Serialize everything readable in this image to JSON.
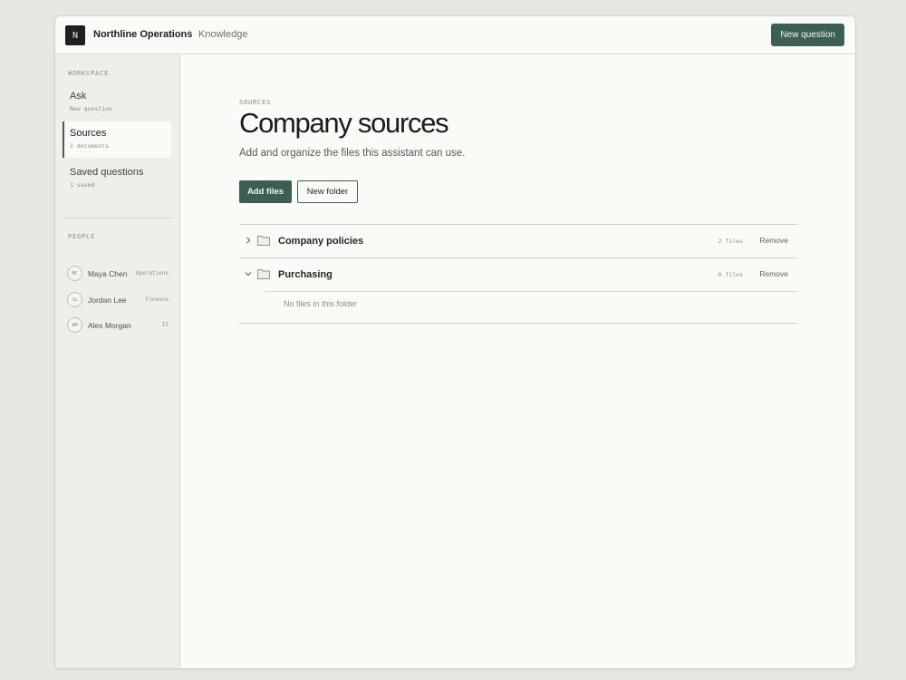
{
  "header": {
    "logo_letter": "N",
    "org_name": "Northline Operations",
    "separator": "/",
    "breadcrumb_page": "Knowledge",
    "new_question_label": "New question"
  },
  "sidebar": {
    "workspace_heading": "WORKSPACE",
    "items": [
      {
        "label": "Ask",
        "sub": "New question",
        "active": false
      },
      {
        "label": "Sources",
        "sub": "2 documents",
        "active": true
      },
      {
        "label": "Saved questions",
        "sub": "1 saved",
        "active": false
      }
    ],
    "people_heading": "PEOPLE",
    "people": [
      {
        "initials": "MC",
        "name": "Maya Chen",
        "team": "Operations"
      },
      {
        "initials": "JL",
        "name": "Jordan Lee",
        "team": "Finance"
      },
      {
        "initials": "AM",
        "name": "Alex Morgan",
        "team": "IT"
      }
    ]
  },
  "main": {
    "eyebrow": "SOURCES",
    "title": "Company sources",
    "description": "Add and organize the files this assistant can use.",
    "add_files_label": "Add files",
    "new_folder_label": "New folder",
    "folders": [
      {
        "name": "Company policies",
        "count": "2 files",
        "remove_label": "Remove",
        "expanded": false,
        "chevron": "›"
      },
      {
        "name": "Purchasing",
        "count": "0 files",
        "remove_label": "Remove",
        "expanded": true,
        "chevron": "⌄",
        "empty_text": "No files in this folder"
      }
    ]
  },
  "colors": {
    "accent": "#3b5f50",
    "background": "#fafbf7",
    "sidebar": "#eeefea",
    "page": "#e7e7e2"
  },
  "icons": {
    "chevron_collapsed": "chevron-right-icon",
    "chevron_expanded": "chevron-down-icon",
    "folder": "folder-icon"
  }
}
